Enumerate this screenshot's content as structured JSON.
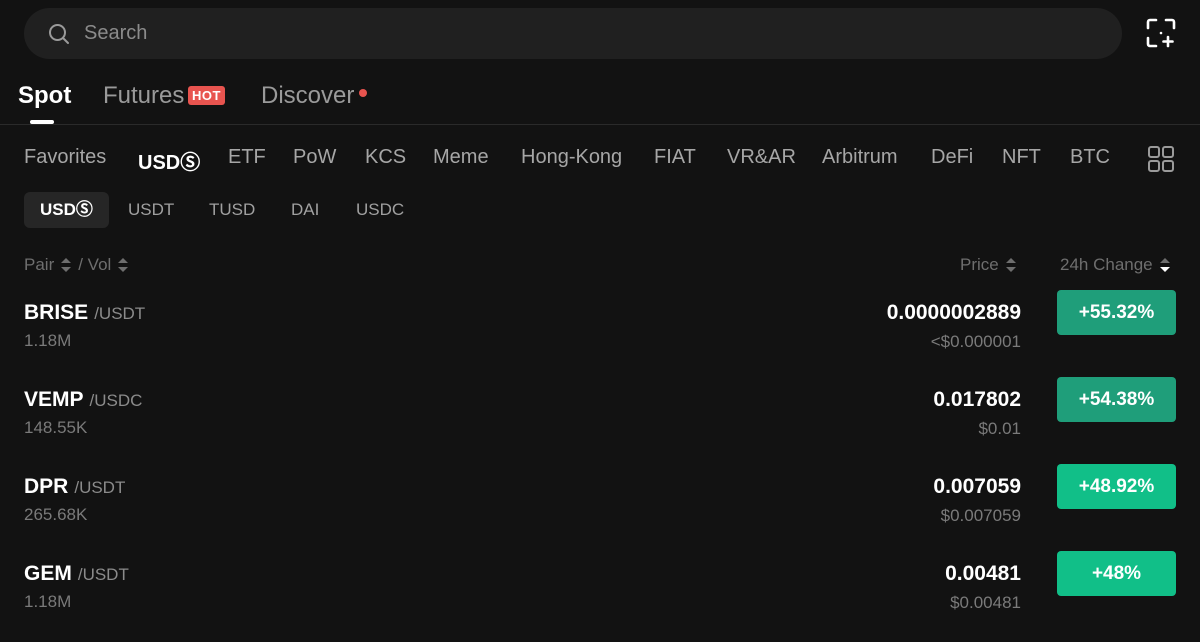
{
  "search": {
    "placeholder": "Search"
  },
  "main_tabs": [
    {
      "label": "Spot"
    },
    {
      "label": "Futures",
      "badge": "HOT"
    },
    {
      "label": "Discover"
    }
  ],
  "categories": [
    "Favorites",
    "USDⓈ",
    "ETF",
    "PoW",
    "KCS",
    "Meme",
    "Hong-Kong",
    "FIAT",
    "VR&AR",
    "Arbitrum",
    "DeFi",
    "NFT",
    "BTC"
  ],
  "sub_tabs": [
    "USDⓈ",
    "USDT",
    "TUSD",
    "DAI",
    "USDC"
  ],
  "headers": {
    "pair": "Pair",
    "vol": "/ Vol",
    "price": "Price",
    "change": "24h Change"
  },
  "colors": {
    "green_strong": "#1f9e7a",
    "green_bright": "#11bf88",
    "badge_red": "#e8544f"
  },
  "rows": [
    {
      "symbol": "BRISE",
      "quote": "/USDT",
      "volume": "1.18M",
      "price": "0.0000002889",
      "usd": "<$0.000001",
      "change": "+55.32%"
    },
    {
      "symbol": "VEMP",
      "quote": "/USDC",
      "volume": "148.55K",
      "price": "0.017802",
      "usd": "$0.01",
      "change": "+54.38%"
    },
    {
      "symbol": "DPR",
      "quote": "/USDT",
      "volume": "265.68K",
      "price": "0.007059",
      "usd": "$0.007059",
      "change": "+48.92%"
    },
    {
      "symbol": "GEM",
      "quote": "/USDT",
      "volume": "1.18M",
      "price": "0.00481",
      "usd": "$0.00481",
      "change": "+48%"
    }
  ]
}
